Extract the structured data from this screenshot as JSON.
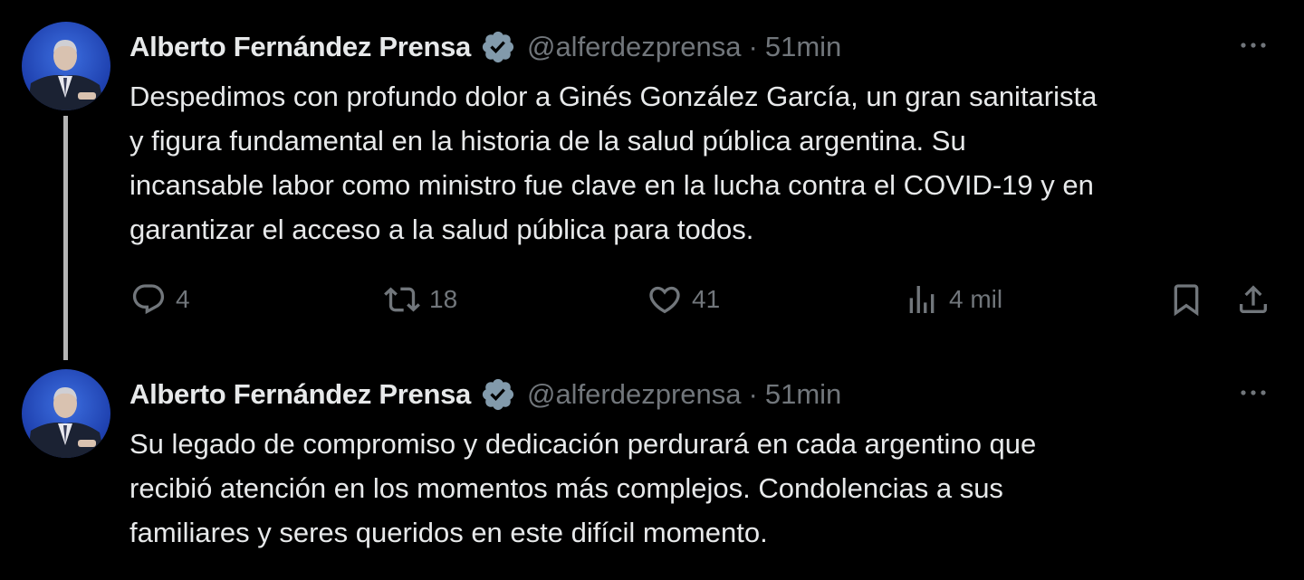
{
  "tweets": [
    {
      "author_name": "Alberto Fernández Prensa",
      "handle": "@alferdezprensa",
      "separator": "·",
      "time": "51min",
      "lines": [
        "Despedimos con profundo dolor a Ginés González García, un gran sanitarista",
        "y figura fundamental en la historia de la salud pública argentina. Su",
        "incansable labor como ministro fue clave en la lucha contra el COVID-19 y en",
        "garantizar el acceso a la salud pública para todos."
      ],
      "actions": {
        "replies": "4",
        "retweets": "18",
        "likes": "41",
        "views": "4 mil"
      }
    },
    {
      "author_name": "Alberto Fernández Prensa",
      "handle": "@alferdezprensa",
      "separator": "·",
      "time": "51min",
      "lines": [
        "Su legado de compromiso y dedicación perdurará en cada argentino que",
        "recibió atención en los momentos más complejos.  Condolencias a sus",
        "familiares y seres queridos en este difícil momento."
      ]
    }
  ],
  "icons": {
    "verified": "verified-badge-icon",
    "more": "more-dots-icon",
    "reply": "reply-icon",
    "retweet": "retweet-icon",
    "like": "heart-icon",
    "views": "views-chart-icon",
    "bookmark": "bookmark-icon",
    "share": "share-icon"
  },
  "colors": {
    "background": "#000000",
    "text_primary": "#e7e9ea",
    "text_secondary": "#71767b",
    "verified_badge": "#829aab",
    "thread_line": "#b5b5b5"
  }
}
